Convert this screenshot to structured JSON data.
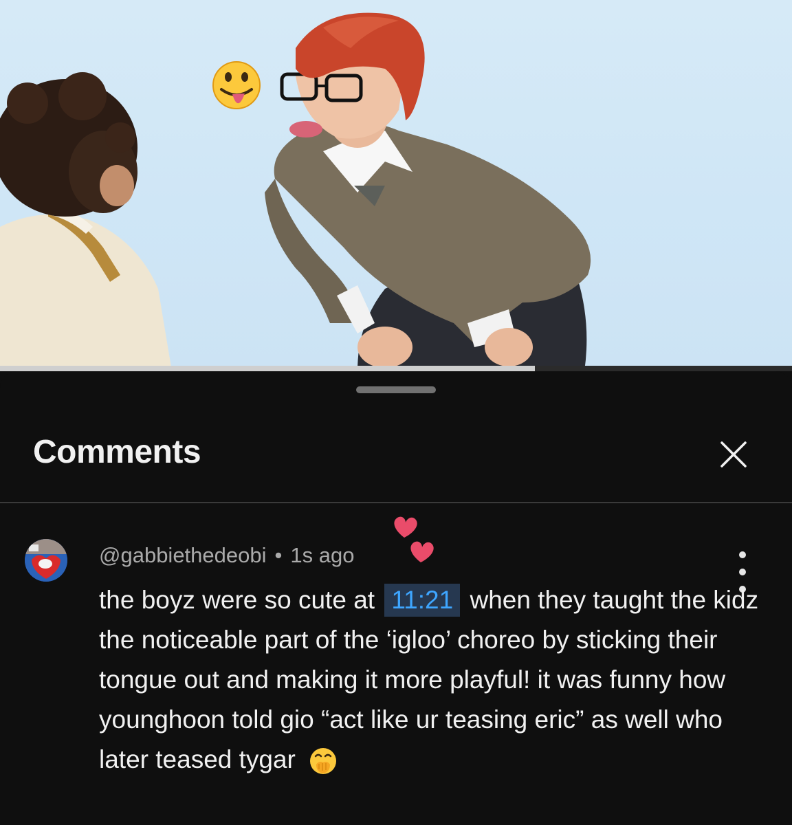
{
  "video": {
    "progress_fraction": 0.675,
    "emoji_name": "tongue-out-emoji"
  },
  "comments_panel": {
    "title": "Comments",
    "close_icon": "close-icon"
  },
  "comment": {
    "author": "@gabbiethedeobi",
    "separator": "•",
    "time": "1s ago",
    "text_before": "the boyz were so cute at",
    "timestamp": "11:21",
    "text_after": "when they taught the kidz the noticeable part of the ‘igloo’ choreo by sticking their tongue out and making it more playful! it was funny how younghoon told gio “act like ur teasing eric” as well who later teased tygar",
    "trailing_emoji": "face-with-hand-over-mouth-emoji",
    "decoration": "two-hearts-emoji",
    "menu_icon": "more-vert-icon"
  },
  "colors": {
    "background": "#0f0f0f",
    "text": "#f1f1f1",
    "secondary_text": "#aaaaaa",
    "timestamp_link": "#3ea6ff",
    "timestamp_bg": "#263850"
  }
}
